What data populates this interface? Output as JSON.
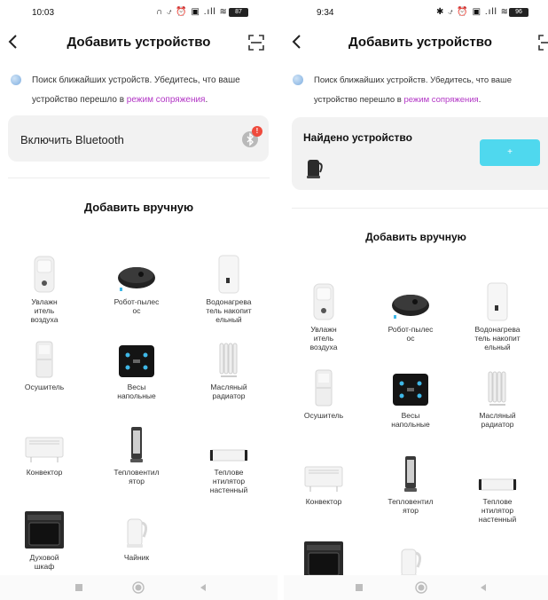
{
  "left": {
    "status": {
      "time": "10:03",
      "icons": "∩ ⍻ ⏰ ▣ .ıll ≋",
      "battery": "87"
    },
    "header": {
      "title": "Добавить устройство"
    },
    "info": {
      "text": "Поиск ближайших устройств. Убедитесь, что ваше устройство перешло в ",
      "link": "режим сопряжения",
      "end": "."
    },
    "bluetooth": {
      "label": "Включить Bluetooth",
      "badge": "!"
    },
    "manual_title": "Добавить вручную",
    "devices": [
      {
        "label": "Увлажн\nитель\nвоздуха",
        "icon": "humidifier-icon"
      },
      {
        "label": "Робот-пылес\nос",
        "icon": "robot-vacuum-icon"
      },
      {
        "label": "Водонагрева\nтель накопит\nельный",
        "icon": "water-heater-icon"
      },
      {
        "label": "Осушитель",
        "icon": "dehumidifier-icon"
      },
      {
        "label": "Весы\nнапольные",
        "icon": "scale-icon"
      },
      {
        "label": "Масляный\nрадиатор",
        "icon": "oil-radiator-icon"
      },
      {
        "label": "Конвектор",
        "icon": "convector-icon"
      },
      {
        "label": "Тепловентил\nятор",
        "icon": "fan-heater-icon"
      },
      {
        "label": "Теплове\nнтилятор\nнастенный",
        "icon": "wall-heater-icon"
      },
      {
        "label": "Духовой\nшкаф",
        "icon": "oven-icon"
      },
      {
        "label": "Чайник",
        "icon": "kettle-icon"
      }
    ]
  },
  "right": {
    "status": {
      "time": "9:34",
      "icons": "✱ ⍻ ⏰ ▣ .ıll ≋",
      "battery": "96"
    },
    "header": {
      "title": "Добавить устройство"
    },
    "info": {
      "text": "Поиск ближайших устройств. Убедитесь, что ваше устройство перешло в ",
      "link": "режим сопряжения",
      "end": "."
    },
    "found": {
      "label": "Найдено устройство",
      "add_label": "+"
    },
    "manual_title": "Добавить вручную",
    "devices": [
      {
        "label": "Увлажн\nитель\nвоздуха",
        "icon": "humidifier-icon"
      },
      {
        "label": "Робот-пылес\nос",
        "icon": "robot-vacuum-icon"
      },
      {
        "label": "Водонагрева\nтель накопит\nельный",
        "icon": "water-heater-icon"
      },
      {
        "label": "Осушитель",
        "icon": "dehumidifier-icon"
      },
      {
        "label": "Весы\nнапольные",
        "icon": "scale-icon"
      },
      {
        "label": "Масляный\nрадиатор",
        "icon": "oil-radiator-icon"
      },
      {
        "label": "Конвектор",
        "icon": "convector-icon"
      },
      {
        "label": "Тепловентил\nятор",
        "icon": "fan-heater-icon"
      },
      {
        "label": "Теплове\nнтилятор\nнастенный",
        "icon": "wall-heater-icon"
      },
      {
        "label": "",
        "icon": "oven-icon"
      },
      {
        "label": "",
        "icon": "kettle-icon"
      }
    ]
  },
  "colors": {
    "link": "#b235c5",
    "add_button": "#4fd8ee",
    "card": "#f2f2f2",
    "badge": "#ef4b3d"
  }
}
